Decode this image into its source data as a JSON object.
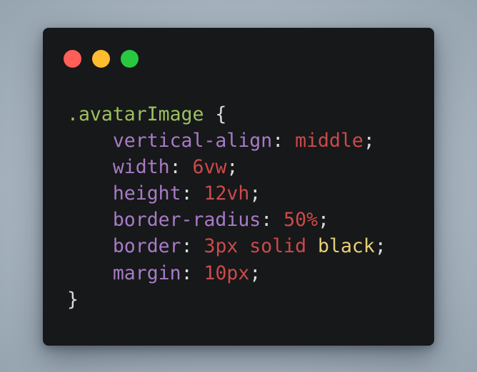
{
  "window": {
    "controls": [
      {
        "name": "close",
        "color": "#fe5f57"
      },
      {
        "name": "minimize",
        "color": "#febc2e"
      },
      {
        "name": "maximize",
        "color": "#28c840"
      }
    ]
  },
  "code": {
    "selector": ".avatarImage",
    "open_brace": "{",
    "close_brace": "}",
    "indent": "    ",
    "declarations": [
      {
        "property": "vertical-align",
        "value": "middle",
        "extra": ""
      },
      {
        "property": "width",
        "value": "6vw",
        "extra": ""
      },
      {
        "property": "height",
        "value": "12vh",
        "extra": ""
      },
      {
        "property": "border-radius",
        "value": "50%",
        "extra": ""
      },
      {
        "property": "border",
        "value": "3px solid",
        "extra": "black"
      },
      {
        "property": "margin",
        "value": "10px",
        "extra": ""
      }
    ],
    "colors": {
      "selector": "#9bc05f",
      "property": "#a77bc6",
      "value": "#cc4a4a",
      "keyword": "#e7cf77",
      "punctuation": "#d9dadb",
      "background": "#171819"
    }
  }
}
